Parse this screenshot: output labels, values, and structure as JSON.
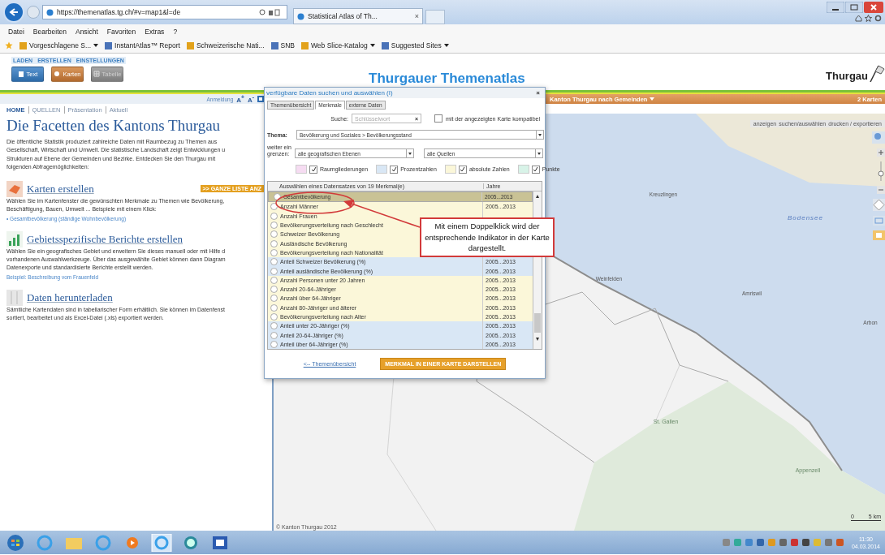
{
  "browser": {
    "address": "https://themenatlas.tg.ch/#v=map1&l=de",
    "tab": "Statistical Atlas of Th...",
    "tab_close": "×",
    "menu": [
      "Datei",
      "Bearbeiten",
      "Ansicht",
      "Favoriten",
      "Extras",
      "?"
    ],
    "favorites": [
      {
        "label": "Vorgeschlagene S...",
        "dropdown": true
      },
      {
        "label": "InstantAtlas™ Report",
        "dropdown": false
      },
      {
        "label": "Schweizerische Nati...",
        "dropdown": false
      },
      {
        "label": "SNB",
        "dropdown": false
      },
      {
        "label": "Web Slice-Katalog",
        "dropdown": true
      },
      {
        "label": "Suggested Sites",
        "dropdown": true
      }
    ]
  },
  "header": {
    "menu": [
      "LADEN",
      "ERSTELLEN",
      "EINSTELLUNGEN"
    ],
    "buttons": [
      {
        "label": "Text",
        "kind": "text",
        "disabled": false
      },
      {
        "label": "Karten",
        "kind": "map",
        "disabled": false
      },
      {
        "label": "Tabelle",
        "kind": "table",
        "disabled": true
      }
    ],
    "title": "Thurgauer Themenatlas",
    "logo": "Thurgau"
  },
  "left": {
    "login": "Anmeldung",
    "text_size": [
      "A$^{+}$",
      "A$^{-}$"
    ],
    "nav": [
      {
        "label": "HOME",
        "selected": true
      },
      {
        "label": "QUELLEN",
        "selected": false
      },
      {
        "label": "Präsentation",
        "selected": false
      },
      {
        "label": "Aktuell",
        "selected": false
      }
    ],
    "title": "Die Facetten des Kantons Thurgau",
    "intro": "Die öffentliche Statistik produziert zahlreiche Daten mit Raumbezug zu Themen aus\nGesellschaft, Wirtschaft und Umwelt. Die statistische Landschaft zeigt Entwicklungen u\nStrukturen auf Ebene der Gemeinden und Bezirke. Entdecken Sie den Thurgau mit\nfolgenden Abfragemöglichkeiten:",
    "sections": [
      {
        "kind": "maps",
        "heading": "Karten erstellen",
        "badge": ">> GANZE LISTE ANZ",
        "text": "Wählen Sie im Kartenfenster die gewünschten Merkmale zu Themen wie Bevölkerung,\nBeschäftigung, Bauen, Umwelt ... Beispiele mit einem Klick:",
        "link": "• Gesamtbevölkerung (ständige Wohnbevölkerung)"
      },
      {
        "kind": "reports",
        "heading": "Gebietsspezifische Berichte erstellen",
        "text": "Wählen Sie ein geografisches Gebiet und erweitern Sie dieses manuell oder mit Hilfe d\nvorhandenen Auswahlwerkzeuge. Über das ausgewählte Gebiet können dann Diagram\nDatenexporte und standardisierte Berichte erstellt werden.",
        "link": "Beispiel: Beschreibung vom Frauenfeld"
      },
      {
        "kind": "download",
        "heading": "Daten herunterladen",
        "text": "Sämtliche Kartendaten sind in tabellarischer Form erhältlich. Sie können im Datenfenst\nsortiert, bearbeitet und als Excel-Datei (.xls) exportiert werden."
      }
    ]
  },
  "map": {
    "title": "Kanton Thurgau nach Gemeinden",
    "count": "2 Karten",
    "tools": [
      "anzeigen",
      "suchen/auswählen",
      "drucken / exportieren"
    ],
    "places": [
      {
        "name": "Kreuzlingen",
        "kind": "town"
      },
      {
        "name": "Bodensee",
        "kind": "lake"
      },
      {
        "name": "Weinfelden",
        "kind": "town"
      },
      {
        "name": "Amriswil",
        "kind": "town"
      },
      {
        "name": "Arbon",
        "kind": "town"
      },
      {
        "name": "St. Gallen",
        "kind": "region"
      },
      {
        "name": "Appenzell",
        "kind": "region"
      }
    ],
    "copyright": "© Kanton Thurgau 2012",
    "scale": [
      "0",
      "5 km"
    ]
  },
  "dialog": {
    "title": "verfügbare Daten suchen und auswählen (I)",
    "close": "×",
    "tabs": [
      {
        "label": "Themenübersicht",
        "selected": false
      },
      {
        "label": "Merkmale",
        "selected": true
      },
      {
        "label": "externe Daten",
        "selected": false
      }
    ],
    "search_label": "Suche:",
    "search_placeholder": "Schlüsselwort",
    "search_clear": "×",
    "compatible": {
      "label": "mit der angezeigten Karte kompatibel",
      "checked": false
    },
    "theme_label": "Thema:",
    "theme": "Bevölkerung und Soziales > Bevölkerungsstand",
    "filter_label": "weiter eingrenzen:",
    "filters": [
      "alle geografischen Ebenen",
      "alle Quellen"
    ],
    "legend": [
      {
        "label": "Raumgliederungen",
        "kind": "area",
        "color": "#f6dcf2",
        "checked": true
      },
      {
        "label": "Prozentzahlen",
        "kind": "percent",
        "color": "#d9e7f5",
        "checked": true
      },
      {
        "label": "absolute Zahlen",
        "kind": "absolute",
        "color": "#fbf7d9",
        "checked": true
      },
      {
        "label": "Punkte",
        "kind": "point",
        "color": "#d8f3e8",
        "checked": true
      }
    ],
    "columns": [
      "Auswählen eines Datensatzes von 19 Merkmal(e)",
      "Jahre"
    ],
    "rows": [
      {
        "name": "Gesamtbevölkerung",
        "kind": "absolute",
        "years": "2005...2013",
        "selected": true
      },
      {
        "name": "Anzahl Männer",
        "kind": "absolute",
        "years": "2005...2013",
        "selected": false
      },
      {
        "name": "Anzahl Frauen",
        "kind": "absolute",
        "selected": false
      },
      {
        "name": "Bevölkerungsverteilung nach Geschlecht",
        "kind": "absolute",
        "selected": false
      },
      {
        "name": "Schweizer Bevölkerung",
        "kind": "absolute",
        "selected": false
      },
      {
        "name": "Ausländische Bevölkerung",
        "kind": "absolute",
        "selected": false
      },
      {
        "name": "Bevölkerungsverteilung nach Nationalität",
        "kind": "absolute",
        "selected": false
      },
      {
        "name": "Anteil Schweizer Bevölkerung (%)",
        "kind": "percent",
        "years": "2005...2013",
        "selected": false
      },
      {
        "name": "Anteil ausländische Bevölkerung (%)",
        "kind": "percent",
        "years": "2005...2013",
        "selected": false
      },
      {
        "name": "Anzahl Personen unter 20 Jahren",
        "kind": "absolute",
        "years": "2005...2013",
        "selected": false
      },
      {
        "name": "Anzahl 20-64-Jähriger",
        "kind": "absolute",
        "years": "2005...2013",
        "selected": false
      },
      {
        "name": "Anzahl über 64-Jähriger",
        "kind": "absolute",
        "years": "2005...2013",
        "selected": false
      },
      {
        "name": "Anzahl 80-Jähriger und älterer",
        "kind": "absolute",
        "years": "2005...2013",
        "selected": false
      },
      {
        "name": "Bevölkerungsverteilung nach Alter",
        "kind": "absolute",
        "years": "2005...2013",
        "selected": false
      },
      {
        "name": "Anteil unter 20-Jähriger (%)",
        "kind": "percent",
        "years": "2005...2013",
        "selected": false
      },
      {
        "name": "Anteil 20-64-Jähriger (%)",
        "kind": "percent",
        "years": "2005...2013",
        "selected": false
      },
      {
        "name": "Anteil über 64-Jähriger (%)",
        "kind": "percent",
        "years": "2005...2013",
        "selected": false
      }
    ],
    "back_link": "<-- Themenübersicht",
    "show_button": "MERKMAL IN EINER KARTE DARSTELLEN"
  },
  "callout": {
    "text": "Mit einem Doppelklick wird der entsprechende Indikator in der Karte dargestellt."
  },
  "taskbar": {
    "time": "11:30",
    "date": "04.03.2014"
  }
}
